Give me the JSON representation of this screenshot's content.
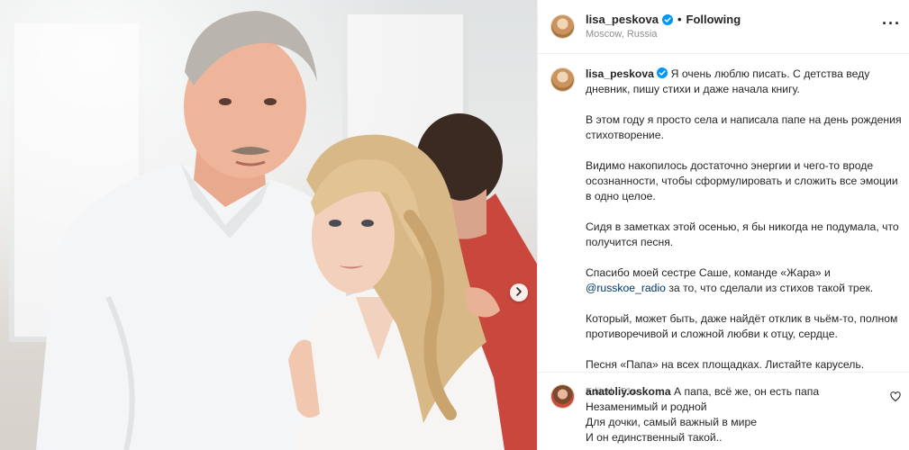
{
  "post": {
    "username": "lisa_peskova",
    "follow_status": "Following",
    "location": "Moscow, Russia",
    "caption_paragraphs": [
      "Я очень люблю писать. С детства веду дневник, пишу стихи и даже начала книгу.",
      "В этом году я просто села и написала папе на день рождения стихотворение.",
      "Видимо накопилось достаточно энергии и чего-то вроде осознанности, чтобы сформулировать и сложить все эмоции в одно целое.",
      "Сидя в заметках этой осенью, я бы никогда не подумала, что получится песня.",
      "Спасибо моей сестре Саше, команде «Жара» и",
      "Который, может быть, даже найдёт отклик в чьём-то, полном противоречивой и сложной любви к отцу, сердце.",
      "Песня «Папа» на всех площадках. Листайте карусель."
    ],
    "mention": "@russkoe_radio",
    "mention_suffix": " за то, что сделали из стихов такой трек.",
    "edited": "Edited · 51w"
  },
  "comment": {
    "username": "anatoliy.oskoma",
    "lines": [
      "А папа, всё же, он есть папа",
      "Незаменимый и родной",
      "Для дочки, самый важный в мире",
      "И он единственный такой.."
    ]
  },
  "icons": {
    "verified": "verified-badge-icon",
    "more": "more-options-icon",
    "next": "chevron-right-icon",
    "like": "heart-icon"
  },
  "colors": {
    "verified_blue": "#0095f6",
    "mention": "#00376b",
    "secondary_text": "#8e8e8e"
  }
}
